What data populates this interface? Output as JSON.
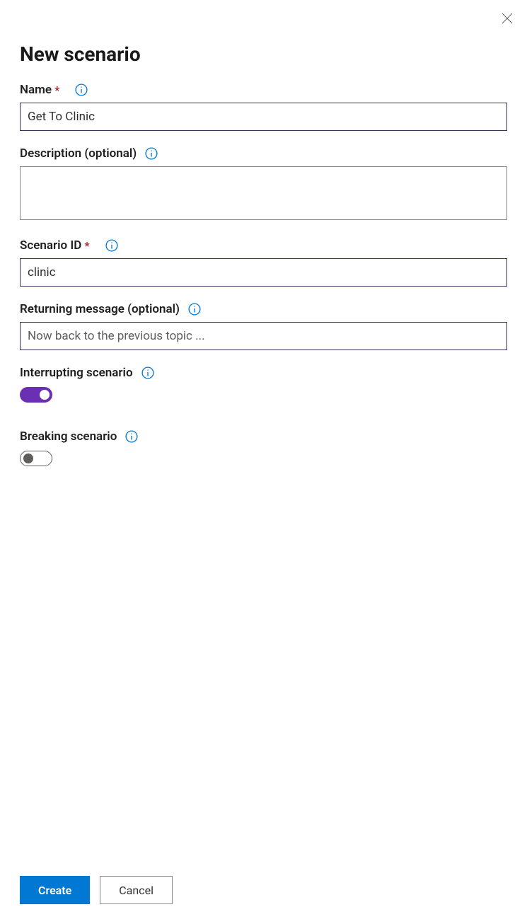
{
  "panel": {
    "title": "New scenario"
  },
  "fields": {
    "name": {
      "label": "Name",
      "value": "Get To Clinic",
      "required_marker": "*"
    },
    "description": {
      "label": "Description (optional)",
      "value": ""
    },
    "scenario_id": {
      "label": "Scenario ID",
      "value": "clinic",
      "required_marker": "*"
    },
    "returning_message": {
      "label": "Returning message (optional)",
      "placeholder": "Now back to the previous topic ...",
      "value": ""
    },
    "interrupting": {
      "label": "Interrupting scenario",
      "value": true
    },
    "breaking": {
      "label": "Breaking scenario",
      "value": false
    }
  },
  "footer": {
    "create_label": "Create",
    "cancel_label": "Cancel"
  },
  "colors": {
    "primary": "#0078d4",
    "accent_purple": "#6b2fb3",
    "input_border_focus": "#3b2e58",
    "required": "#a4262c"
  }
}
